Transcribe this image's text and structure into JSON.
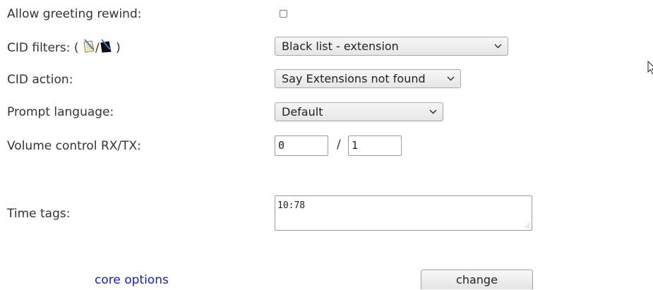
{
  "form": {
    "greeting_rewind": {
      "label": "Allow greeting rewind:",
      "checked": false
    },
    "cid_filters": {
      "label_prefix": "CID filters: (",
      "separator": "/",
      "label_suffix": ")",
      "icons": [
        "edit-list-icon",
        "black-list-edit-icon"
      ],
      "value": "Black list - extension"
    },
    "cid_action": {
      "label": "CID action:",
      "value": "Say Extensions not found"
    },
    "prompt_language": {
      "label": "Prompt language:",
      "value": "Default"
    },
    "volume_control": {
      "label": "Volume control RX/TX:",
      "rx_value": "0",
      "separator": "/",
      "tx_value": "1"
    },
    "time_tags": {
      "label": "Time tags:",
      "value": "10:78"
    }
  },
  "footer": {
    "link_label": "core options",
    "button_label": "change"
  },
  "colors": {
    "link": "#1a1acc",
    "text": "#333333"
  }
}
